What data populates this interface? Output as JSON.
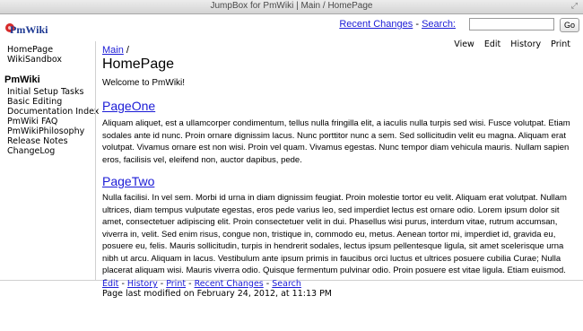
{
  "window": {
    "title": "JumpBox for PmWiki | Main / HomePage"
  },
  "header": {
    "logo_text": "PmWiki",
    "recent_changes": "Recent Changes",
    "dash": "-",
    "search_label": "Search:",
    "search_value": "",
    "go_label": "Go"
  },
  "sidebar": {
    "top_items": [
      "HomePage",
      "WikiSandbox"
    ],
    "heading": "PmWiki",
    "items": [
      "Initial Setup Tasks",
      "Basic Editing",
      "Documentation Index",
      "PmWiki FAQ",
      "PmWikiPhilosophy",
      "Release Notes",
      "ChangeLog"
    ]
  },
  "page": {
    "breadcrumb_link": "Main",
    "breadcrumb_sep": " /",
    "title": "HomePage",
    "welcome": "Welcome to PmWiki!",
    "actions": [
      "View",
      "Edit",
      "History",
      "Print"
    ],
    "sections": [
      {
        "heading": "PageOne",
        "text": "Aliquam aliquet, est a ullamcorper condimentum, tellus nulla fringilla elit, a iaculis nulla turpis sed wisi. Fusce volutpat. Etiam sodales ante id nunc. Proin ornare dignissim lacus. Nunc porttitor nunc a sem. Sed sollicitudin velit eu magna. Aliquam erat volutpat. Vivamus ornare est non wisi. Proin vel quam. Vivamus egestas. Nunc tempor diam vehicula mauris. Nullam sapien eros, facilisis vel, eleifend non, auctor dapibus, pede."
      },
      {
        "heading": "PageTwo",
        "text": "Nulla facilisi. In vel sem. Morbi id urna in diam dignissim feugiat. Proin molestie tortor eu velit. Aliquam erat volutpat. Nullam ultrices, diam tempus vulputate egestas, eros pede varius leo, sed imperdiet lectus est ornare odio. Lorem ipsum dolor sit amet, consectetuer adipiscing elit. Proin consectetuer velit in dui. Phasellus wisi purus, interdum vitae, rutrum accumsan, viverra in, velit. Sed enim risus, congue non, tristique in, commodo eu, metus. Aenean tortor mi, imperdiet id, gravida eu, posuere eu, felis. Mauris sollicitudin, turpis in hendrerit sodales, lectus ipsum pellentesque ligula, sit amet scelerisque urna nibh ut arcu. Aliquam in lacus. Vestibulum ante ipsum primis in faucibus orci luctus et ultrices posuere cubilia Curae; Nulla placerat aliquam wisi. Mauris viverra odio. Quisque fermentum pulvinar odio. Proin posuere est vitae ligula. Etiam euismod. Cras a eros."
      }
    ]
  },
  "footer": {
    "links": [
      "Edit",
      "History",
      "Print",
      "Recent Changes",
      "Search"
    ],
    "dash": "-",
    "last_modified": "Page last modified on February 24, 2012, at 11:13 PM"
  },
  "colors": {
    "link": "#1b1bd6",
    "logo": "#1f3a93",
    "logo_accent": "#d62a2a"
  }
}
